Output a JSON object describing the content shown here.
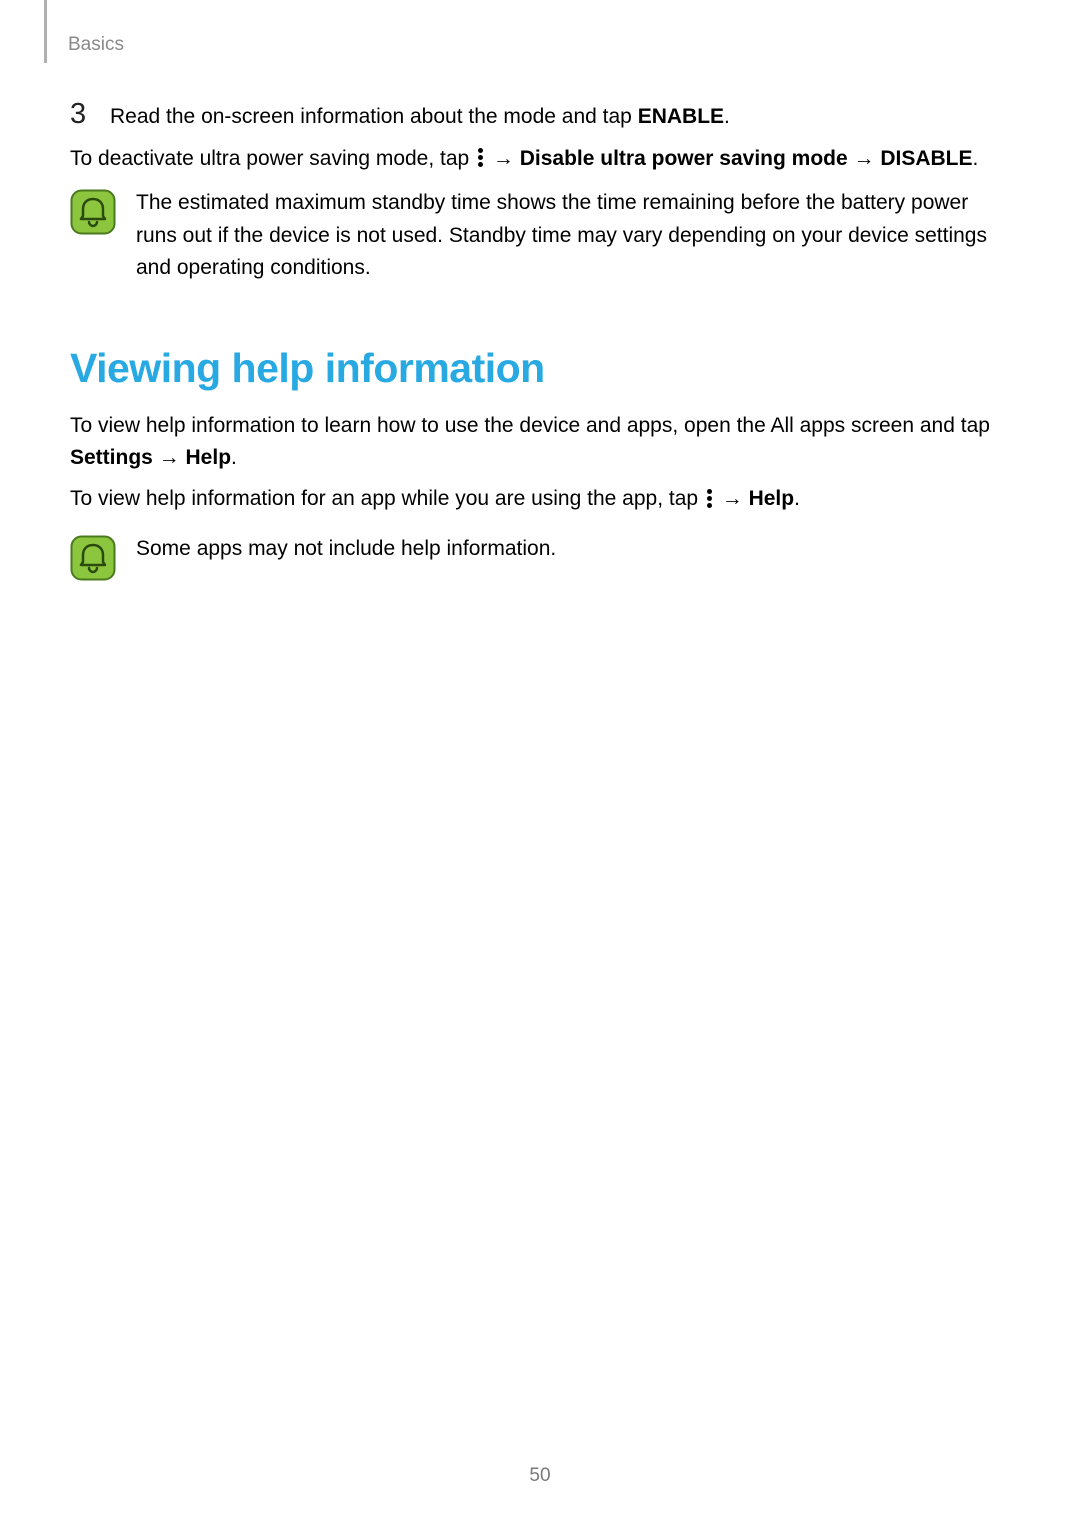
{
  "header": {
    "section": "Basics"
  },
  "step": {
    "number": "3",
    "text_pre": "Read the on-screen information about the mode and tap ",
    "text_bold": "ENABLE",
    "text_post": "."
  },
  "deactivate": {
    "pre": "To deactivate ultra power saving mode, tap ",
    "arrow1": " → ",
    "bold1": "Disable ultra power saving mode",
    "arrow2": " → ",
    "bold2": "DISABLE",
    "post": "."
  },
  "note1": {
    "text": "The estimated maximum standby time shows the time remaining before the battery power runs out if the device is not used. Standby time may vary depending on your device settings and operating conditions."
  },
  "heading": "Viewing help information",
  "help1": {
    "pre": "To view help information to learn how to use the device and apps, open the All apps screen and tap ",
    "bold1": "Settings",
    "arrow": " → ",
    "bold2": "Help",
    "post": "."
  },
  "help2": {
    "pre": "To view help information for an app while you are using the app, tap ",
    "arrow": " → ",
    "bold": "Help",
    "post": "."
  },
  "note2": {
    "text": "Some apps may not include help information."
  },
  "page": "50"
}
